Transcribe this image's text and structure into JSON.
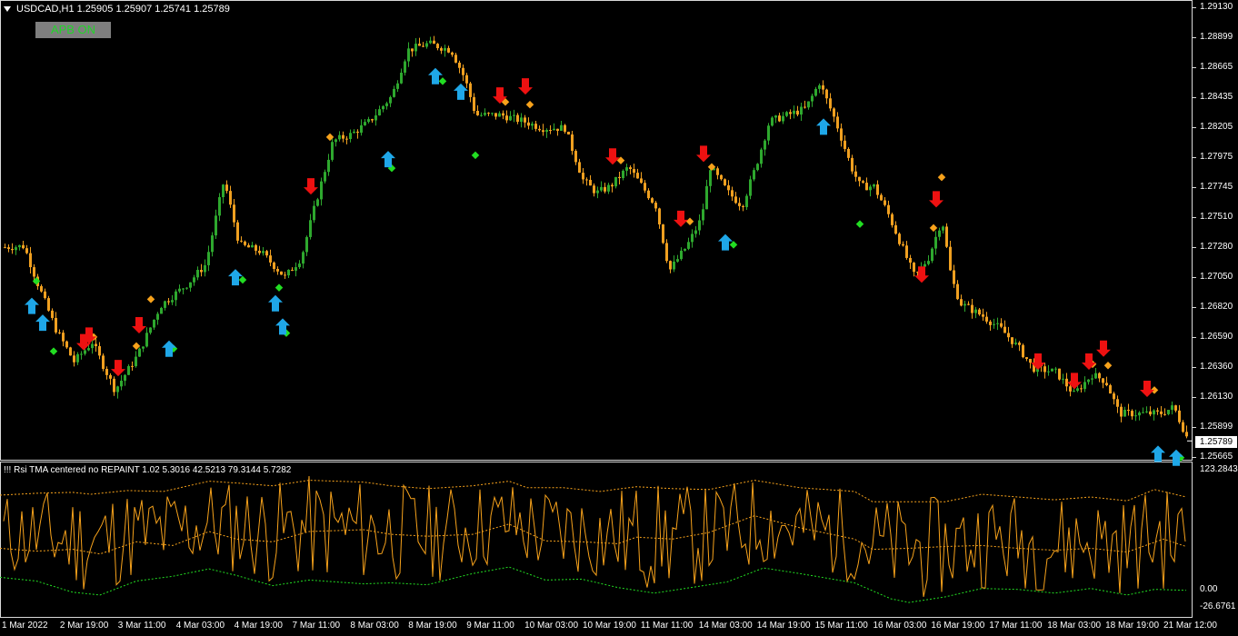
{
  "chart_header": {
    "symbol_line": "USDCAD,H1  1.25905 1.25907 1.25741 1.25789",
    "button_label": "APB ON"
  },
  "indicator": {
    "title": "!!! Rsi TMA centered no REPAINT 1.02 5.3016 42.5213 79.3144 5.7282",
    "axis_top": "123.2843",
    "axis_mid": "0.00",
    "axis_bottom": "-26.6761"
  },
  "current_price": "1.25789",
  "colors": {
    "up": "#2ea82e",
    "down": "#f0a020",
    "buy_arrow": "#1fa7e8",
    "sell_arrow": "#ee1111",
    "green_dot": "#22dd22",
    "orange_dot": "#f7a21b"
  },
  "chart_data": {
    "type": "candlestick",
    "symbol": "USDCAD",
    "timeframe": "H1",
    "ylim": [
      1.25665,
      1.2913
    ],
    "price_ticks": [
      "1.29130",
      "1.28899",
      "1.28665",
      "1.28435",
      "1.28205",
      "1.27975",
      "1.27745",
      "1.27510",
      "1.27280",
      "1.27050",
      "1.26820",
      "1.26590",
      "1.26360",
      "1.26130",
      "1.25899",
      "1.25665"
    ],
    "time_ticks": [
      "1 Mar 2022",
      "2 Mar 19:00",
      "3 Mar 11:00",
      "4 Mar 03:00",
      "4 Mar 19:00",
      "7 Mar 11:00",
      "8 Mar 03:00",
      "8 Mar 19:00",
      "9 Mar 11:00",
      "10 Mar 03:00",
      "10 Mar 19:00",
      "11 Mar 11:00",
      "14 Mar 03:00",
      "14 Mar 19:00",
      "15 Mar 11:00",
      "16 Mar 03:00",
      "16 Mar 19:00",
      "17 Mar 11:00",
      "18 Mar 03:00",
      "18 Mar 19:00",
      "21 Mar 12:00"
    ],
    "price_path": [
      [
        0,
        1.2728
      ],
      [
        25,
        1.2729
      ],
      [
        40,
        1.27
      ],
      [
        60,
        1.2665
      ],
      [
        80,
        1.264
      ],
      [
        100,
        1.2655
      ],
      [
        125,
        1.2618
      ],
      [
        150,
        1.2645
      ],
      [
        175,
        1.2683
      ],
      [
        205,
        1.27
      ],
      [
        225,
        1.2715
      ],
      [
        245,
        1.278
      ],
      [
        262,
        1.273
      ],
      [
        285,
        1.2725
      ],
      [
        312,
        1.2705
      ],
      [
        330,
        1.272
      ],
      [
        345,
        1.276
      ],
      [
        365,
        1.281
      ],
      [
        385,
        1.2815
      ],
      [
        405,
        1.2825
      ],
      [
        430,
        1.2845
      ],
      [
        447,
        1.288
      ],
      [
        470,
        1.2885
      ],
      [
        495,
        1.288
      ],
      [
        510,
        1.2858
      ],
      [
        522,
        1.283
      ],
      [
        550,
        1.283
      ],
      [
        575,
        1.2825
      ],
      [
        595,
        1.282
      ],
      [
        620,
        1.282
      ],
      [
        640,
        1.278
      ],
      [
        655,
        1.277
      ],
      [
        670,
        1.2775
      ],
      [
        690,
        1.279
      ],
      [
        705,
        1.2775
      ],
      [
        720,
        1.276
      ],
      [
        735,
        1.271
      ],
      [
        755,
        1.273
      ],
      [
        770,
        1.275
      ],
      [
        780,
        1.279
      ],
      [
        800,
        1.277
      ],
      [
        815,
        1.276
      ],
      [
        830,
        1.279
      ],
      [
        845,
        1.2825
      ],
      [
        865,
        1.283
      ],
      [
        885,
        1.2835
      ],
      [
        900,
        1.2855
      ],
      [
        918,
        1.2825
      ],
      [
        935,
        1.279
      ],
      [
        945,
        1.2775
      ],
      [
        960,
        1.2775
      ],
      [
        975,
        1.2755
      ],
      [
        990,
        1.273
      ],
      [
        1005,
        1.2705
      ],
      [
        1020,
        1.272
      ],
      [
        1035,
        1.275
      ],
      [
        1045,
        1.2705
      ],
      [
        1055,
        1.2685
      ],
      [
        1080,
        1.2675
      ],
      [
        1100,
        1.2665
      ],
      [
        1120,
        1.265
      ],
      [
        1135,
        1.2635
      ],
      [
        1160,
        1.2632
      ],
      [
        1180,
        1.2615
      ],
      [
        1200,
        1.263
      ],
      [
        1215,
        1.2625
      ],
      [
        1230,
        1.26
      ],
      [
        1255,
        1.26
      ],
      [
        1275,
        1.26
      ],
      [
        1290,
        1.2605
      ],
      [
        1306,
        1.2579
      ]
    ],
    "signals": [
      {
        "t": "buy",
        "x": 35,
        "p": 1.2683
      },
      {
        "t": "buy",
        "x": 47,
        "p": 1.267
      },
      {
        "t": "sell",
        "x": 92,
        "p": 1.2655
      },
      {
        "t": "sell",
        "x": 98,
        "p": 1.266
      },
      {
        "t": "sell",
        "x": 130,
        "p": 1.2635
      },
      {
        "t": "sell",
        "x": 153,
        "p": 1.2668
      },
      {
        "t": "buy",
        "x": 186,
        "p": 1.265
      },
      {
        "t": "buy",
        "x": 259,
        "p": 1.2705
      },
      {
        "t": "buy",
        "x": 303,
        "p": 1.2685
      },
      {
        "t": "buy",
        "x": 311,
        "p": 1.2667
      },
      {
        "t": "sell",
        "x": 342,
        "p": 1.2775
      },
      {
        "t": "buy",
        "x": 427,
        "p": 1.2796
      },
      {
        "t": "buy",
        "x": 479,
        "p": 1.286
      },
      {
        "t": "buy",
        "x": 507,
        "p": 1.2848
      },
      {
        "t": "sell",
        "x": 550,
        "p": 1.2845
      },
      {
        "t": "sell",
        "x": 578,
        "p": 1.2852
      },
      {
        "t": "sell",
        "x": 674,
        "p": 1.2798
      },
      {
        "t": "sell",
        "x": 749,
        "p": 1.275
      },
      {
        "t": "sell",
        "x": 774,
        "p": 1.28
      },
      {
        "t": "buy",
        "x": 798,
        "p": 1.2732
      },
      {
        "t": "buy",
        "x": 906,
        "p": 1.2821
      },
      {
        "t": "sell",
        "x": 1014,
        "p": 1.2707
      },
      {
        "t": "sell",
        "x": 1030,
        "p": 1.2765
      },
      {
        "t": "sell",
        "x": 1142,
        "p": 1.264
      },
      {
        "t": "sell",
        "x": 1182,
        "p": 1.2625
      },
      {
        "t": "sell",
        "x": 1198,
        "p": 1.264
      },
      {
        "t": "sell",
        "x": 1214,
        "p": 1.265
      },
      {
        "t": "sell",
        "x": 1262,
        "p": 1.2619
      },
      {
        "t": "buy",
        "x": 1274,
        "p": 1.2569
      },
      {
        "t": "buy",
        "x": 1294,
        "p": 1.2566
      }
    ],
    "dots": [
      {
        "c": "green",
        "x": 40,
        "p": 1.2702
      },
      {
        "c": "green",
        "x": 59,
        "p": 1.2648
      },
      {
        "c": "orange",
        "x": 103,
        "p": 1.2659
      },
      {
        "c": "orange",
        "x": 150,
        "p": 1.2652
      },
      {
        "c": "orange",
        "x": 166,
        "p": 1.2688
      },
      {
        "c": "green",
        "x": 191,
        "p": 1.265
      },
      {
        "c": "green",
        "x": 267,
        "p": 1.2703
      },
      {
        "c": "green",
        "x": 307,
        "p": 1.2697
      },
      {
        "c": "green",
        "x": 315,
        "p": 1.2662
      },
      {
        "c": "orange",
        "x": 363,
        "p": 1.2813
      },
      {
        "c": "green",
        "x": 431,
        "p": 1.2789
      },
      {
        "c": "green",
        "x": 487,
        "p": 1.2856
      },
      {
        "c": "green",
        "x": 523,
        "p": 1.2799
      },
      {
        "c": "orange",
        "x": 556,
        "p": 1.284
      },
      {
        "c": "orange",
        "x": 583,
        "p": 1.2838
      },
      {
        "c": "orange",
        "x": 683,
        "p": 1.2795
      },
      {
        "c": "orange",
        "x": 759,
        "p": 1.2748
      },
      {
        "c": "orange",
        "x": 783,
        "p": 1.279
      },
      {
        "c": "green",
        "x": 807,
        "p": 1.273
      },
      {
        "c": "green",
        "x": 946,
        "p": 1.2746
      },
      {
        "c": "orange",
        "x": 1027,
        "p": 1.2743
      },
      {
        "c": "orange",
        "x": 1036,
        "p": 1.2782
      },
      {
        "c": "orange",
        "x": 1202,
        "p": 1.2638
      },
      {
        "c": "orange",
        "x": 1219,
        "p": 1.2637
      },
      {
        "c": "orange",
        "x": 1270,
        "p": 1.2618
      },
      {
        "c": "green",
        "x": 1299,
        "p": 1.2566
      }
    ],
    "rsi": {
      "ylim": [
        -26.6761,
        123.2843
      ],
      "upper_band": [
        [
          0,
          97
        ],
        [
          40,
          99
        ],
        [
          80,
          100
        ],
        [
          100,
          98
        ],
        [
          140,
          102
        ],
        [
          180,
          101
        ],
        [
          230,
          112
        ],
        [
          260,
          110
        ],
        [
          300,
          107
        ],
        [
          340,
          113
        ],
        [
          400,
          111
        ],
        [
          430,
          107
        ],
        [
          470,
          104
        ],
        [
          520,
          107
        ],
        [
          560,
          112
        ],
        [
          580,
          105
        ],
        [
          620,
          105
        ],
        [
          660,
          101
        ],
        [
          700,
          106
        ],
        [
          740,
          104
        ],
        [
          780,
          103
        ],
        [
          830,
          113
        ],
        [
          880,
          105
        ],
        [
          940,
          101
        ],
        [
          960,
          90
        ],
        [
          1000,
          90
        ],
        [
          1040,
          90
        ],
        [
          1080,
          98
        ],
        [
          1120,
          95
        ],
        [
          1160,
          92
        ],
        [
          1200,
          95
        ],
        [
          1240,
          91
        ],
        [
          1270,
          103
        ],
        [
          1305,
          95
        ]
      ],
      "mid_band": [
        [
          0,
          40
        ],
        [
          40,
          37
        ],
        [
          80,
          39
        ],
        [
          110,
          34
        ],
        [
          150,
          47
        ],
        [
          190,
          43
        ],
        [
          230,
          58
        ],
        [
          260,
          50
        ],
        [
          300,
          47
        ],
        [
          340,
          58
        ],
        [
          400,
          60
        ],
        [
          430,
          55
        ],
        [
          470,
          53
        ],
        [
          520,
          55
        ],
        [
          560,
          66
        ],
        [
          600,
          48
        ],
        [
          640,
          47
        ],
        [
          680,
          45
        ],
        [
          700,
          52
        ],
        [
          740,
          50
        ],
        [
          780,
          57
        ],
        [
          830,
          75
        ],
        [
          880,
          62
        ],
        [
          940,
          50
        ],
        [
          960,
          39
        ],
        [
          1000,
          40
        ],
        [
          1040,
          42
        ],
        [
          1080,
          43
        ],
        [
          1120,
          40
        ],
        [
          1160,
          38
        ],
        [
          1200,
          40
        ],
        [
          1240,
          36
        ],
        [
          1280,
          50
        ],
        [
          1305,
          42
        ]
      ],
      "lower_band": [
        [
          0,
          9
        ],
        [
          40,
          5
        ],
        [
          80,
          -7
        ],
        [
          110,
          -10
        ],
        [
          150,
          5
        ],
        [
          190,
          10
        ],
        [
          230,
          18
        ],
        [
          260,
          11
        ],
        [
          300,
          0
        ],
        [
          340,
          6
        ],
        [
          400,
          2
        ],
        [
          430,
          3
        ],
        [
          470,
          1
        ],
        [
          520,
          13
        ],
        [
          560,
          20
        ],
        [
          600,
          6
        ],
        [
          640,
          7
        ],
        [
          680,
          -2
        ],
        [
          720,
          -8
        ],
        [
          760,
          -2
        ],
        [
          800,
          4
        ],
        [
          840,
          19
        ],
        [
          880,
          13
        ],
        [
          940,
          3
        ],
        [
          980,
          -14
        ],
        [
          1000,
          -18
        ],
        [
          1040,
          -12
        ],
        [
          1080,
          -3
        ],
        [
          1120,
          -4
        ],
        [
          1160,
          -8
        ],
        [
          1200,
          -3
        ],
        [
          1240,
          -10
        ],
        [
          1270,
          -4
        ],
        [
          1305,
          -5
        ]
      ]
    }
  }
}
